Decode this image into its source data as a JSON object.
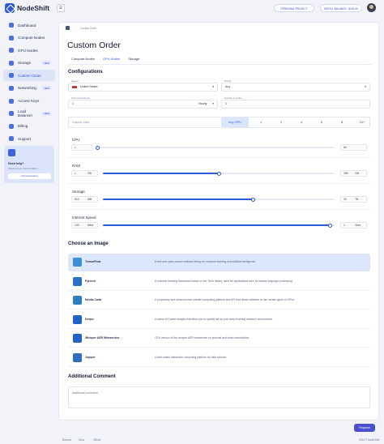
{
  "app": {
    "name": "NodeShift"
  },
  "header": {
    "project_label": "PERSONAL PROJECT",
    "balance_label": "INSTILL BALANCE : $100.00"
  },
  "sidebar": {
    "items": [
      {
        "label": "Dashboard",
        "icon": "dashboard-icon"
      },
      {
        "label": "Compute Nodes",
        "icon": "server-icon"
      },
      {
        "label": "GPU Nodes",
        "icon": "gpu-icon"
      },
      {
        "label": "Storage",
        "icon": "storage-icon",
        "badge": "NEW"
      },
      {
        "label": "Custom Order",
        "icon": "custom-order-icon",
        "active": true
      },
      {
        "label": "Networking",
        "icon": "network-icon",
        "badge": "NEW"
      },
      {
        "label": "Access Keys",
        "icon": "key-icon"
      },
      {
        "label": "Load Balancer",
        "icon": "balancer-icon",
        "badge": "NEW"
      },
      {
        "label": "Billing",
        "icon": "billing-icon"
      },
      {
        "label": "Support",
        "icon": "support-icon"
      }
    ],
    "help": {
      "title": "Need help?",
      "subtitle": "Check out our documentation",
      "button": "Documentation"
    }
  },
  "breadcrumb": {
    "current": "Custom Order"
  },
  "page": {
    "title": "Custom Order"
  },
  "tabs": [
    {
      "label": "Compute Nodes"
    },
    {
      "label": "GPU Nodes",
      "active": true
    },
    {
      "label": "Storage"
    }
  ],
  "configurations": {
    "heading": "Configurations",
    "region": {
      "label": "Region",
      "value": "United States"
    },
    "priority": {
      "label": "Priority",
      "value": "Any"
    },
    "commitment": {
      "label": "Term Commitment",
      "value": "1",
      "unit": "Hourly"
    },
    "nodes": {
      "label": "Number of nodes",
      "value": "1"
    },
    "gpu": {
      "placeholder": "Graphic Card",
      "options": [
        "Any GPU",
        "1",
        "2",
        "4",
        "6",
        "8",
        "10+"
      ],
      "selected": "Any GPU"
    }
  },
  "resources": {
    "cpu": {
      "label": "CPU",
      "min": "1",
      "max": "60",
      "fill": 0.0
    },
    "ram": {
      "label": "RAM",
      "min": "1",
      "min_unit": "GB",
      "max": "256",
      "max_unit": "GB",
      "fill": 0.5
    },
    "storage": {
      "label": "Storage",
      "min": "512",
      "min_unit": "MB",
      "max": "20",
      "max_unit": "TB",
      "fill": 0.65
    },
    "speed": {
      "label": "Internet Speed",
      "min": "100",
      "min_unit": "Mb/s",
      "max": "1",
      "max_unit": "Gb/s",
      "fill": 0.98
    }
  },
  "images": {
    "heading": "Choose an Image",
    "list": [
      {
        "name": "TensorFlow",
        "desc": "A free and open-source software library for machine learning and artificial intelligence.",
        "color": "#3d8ed8",
        "selected": true
      },
      {
        "name": "Pytorch",
        "desc": "A machine learning framework based on the Torch library, used for applications such as natural language processing.",
        "color": "#2a6fc9"
      },
      {
        "name": "Nvidia Cuda",
        "desc": "A proprietary and closed source parallel computing platform and API that allows software to use certain types of GPUs.",
        "color": "#2d7fc0"
      },
      {
        "name": "Deepo",
        "desc": "A series of Docker images that allow you to quickly set up your deep learning research environment.",
        "color": "#1f64c6"
      },
      {
        "name": "Whisper ASR Webservice",
        "desc": "GPU version of the whisper ASR webservice for podcast and video transcription.",
        "color": "#2364c2"
      },
      {
        "name": "Jupyter",
        "desc": "A web-based interactive computing platform for data science.",
        "color": "#2f6cc2"
      }
    ]
  },
  "comment": {
    "heading": "Additional Comment",
    "placeholder": "Additional comment"
  },
  "actions": {
    "request": "Request"
  },
  "footer": {
    "links": [
      "Discord",
      "Docs",
      "Github"
    ],
    "copyright": "2024 © NodeShift"
  }
}
